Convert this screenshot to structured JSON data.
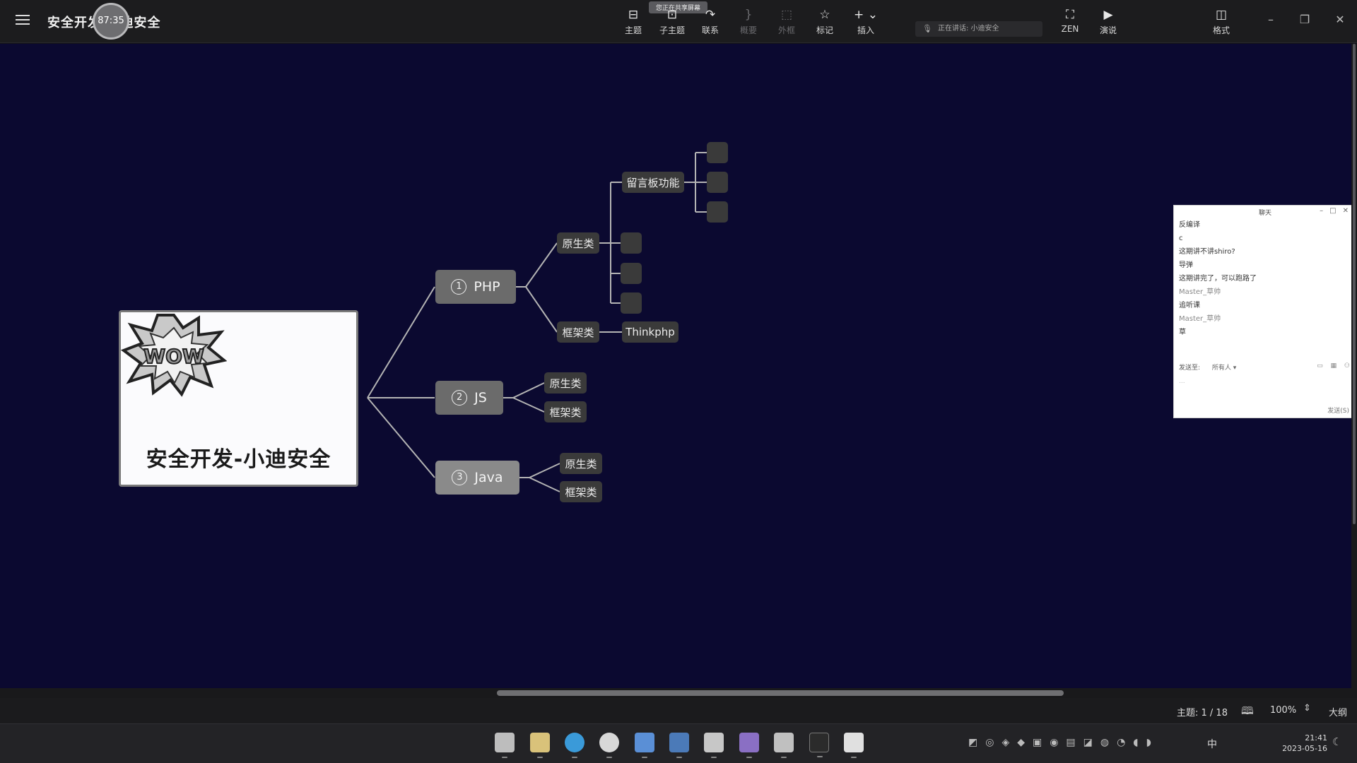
{
  "header": {
    "document_title": "安全开发-小迪安全",
    "timer": "87:35",
    "share_tip": "您正在共享屏幕",
    "speaking": "正在讲话: 小迪安全",
    "tools": [
      {
        "label": "主题",
        "icon": "topic-icon"
      },
      {
        "label": "子主题",
        "icon": "subtopic-icon"
      },
      {
        "label": "联系",
        "icon": "relationship-icon"
      },
      {
        "label": "概要",
        "icon": "summary-icon"
      },
      {
        "label": "外框",
        "icon": "boundary-icon"
      },
      {
        "label": "标记",
        "icon": "star-icon"
      },
      {
        "label": "插入",
        "icon": "plus-icon"
      },
      {
        "label": "ZEN",
        "icon": "fullscreen-icon"
      },
      {
        "label": "演说",
        "icon": "present-icon"
      },
      {
        "label": "格式",
        "icon": "format-panel-icon"
      }
    ]
  },
  "mindmap": {
    "root": "安全开发-小迪安全",
    "root_art_text": "WOW",
    "branches": [
      {
        "num": "1",
        "label": "PHP",
        "children": [
          {
            "label": "原生类",
            "children": [
              "留言板功能",
              "",
              "",
              ""
            ],
            "grandchildren": [
              "",
              "",
              ""
            ]
          },
          {
            "label": "框架类",
            "children": [
              "Thinkphp"
            ]
          }
        ]
      },
      {
        "num": "2",
        "label": "JS",
        "children": [
          {
            "label": "原生类"
          },
          {
            "label": "框架类"
          }
        ]
      },
      {
        "num": "3",
        "label": "Java",
        "children": [
          {
            "label": "原生类"
          },
          {
            "label": "框架类"
          }
        ]
      }
    ]
  },
  "chat": {
    "title": "聊天",
    "messages": [
      {
        "text": "反编译",
        "is_name": false
      },
      {
        "text": "c",
        "is_name": false
      },
      {
        "text": "这期讲不讲shiro?",
        "is_name": false
      },
      {
        "text": "导弹",
        "is_name": false
      },
      {
        "text": "这期讲完了，可以跑路了",
        "is_name": false
      },
      {
        "text": "Master_草帅",
        "is_name": true
      },
      {
        "text": "追听课",
        "is_name": false
      },
      {
        "text": "Master_草帅",
        "is_name": true
      },
      {
        "text": "草",
        "is_name": false
      }
    ],
    "send_to_label": "发送至:",
    "send_to_target": "所有人 ▾",
    "input_placeholder": "...",
    "send_button": "发送(S)"
  },
  "status": {
    "topic_count": "主题: 1 / 18",
    "zoom": "100%",
    "outline": "大纲"
  },
  "taskbar": {
    "ime": "中",
    "time": "21:41",
    "date": "2023-05-16"
  },
  "colors": {
    "canvas": "#0b0930",
    "main_node": "#6b6b6b",
    "sub_node": "#3a3a3a",
    "connector": "#b4b4b4"
  }
}
